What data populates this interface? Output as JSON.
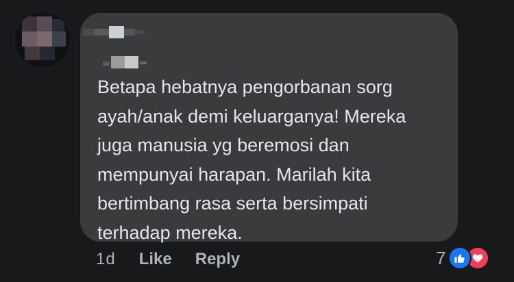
{
  "comment": {
    "text": "Betapa hebatnya pengorbanan sorg\nayah/anak demi keluarganya! Mereka\njuga manusia yg beremosi dan\nmempunyai harapan. Marilah kita\nbertimbang rasa serta bersimpati\nterhadap mereka."
  },
  "actions": {
    "time": "1d",
    "like_label": "Like",
    "reply_label": "Reply"
  },
  "reactions": {
    "count": "7",
    "types": [
      "like-icon",
      "love-icon"
    ],
    "like_color": "#1877f2",
    "love_color": "#f33e58"
  },
  "theme": {
    "background": "#18191a",
    "bubble": "#3a3b3c",
    "text": "#e4e6eb",
    "muted": "#b0b3b8"
  }
}
